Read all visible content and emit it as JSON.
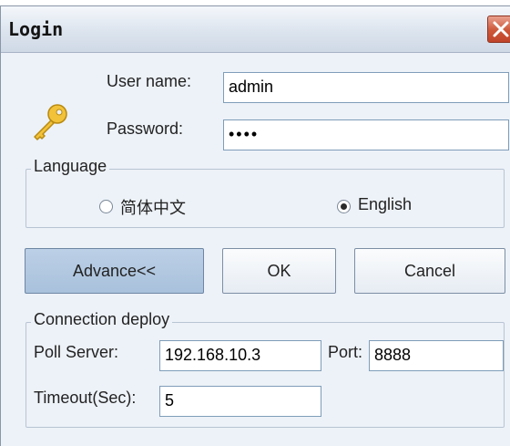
{
  "window": {
    "title": "Login"
  },
  "login": {
    "username_label": "User name:",
    "username_value": "admin",
    "password_label": "Password:",
    "password_mask": "••••"
  },
  "language": {
    "legend": "Language",
    "options": [
      {
        "label": "简体中文",
        "checked": false
      },
      {
        "label": "English",
        "checked": true
      }
    ]
  },
  "buttons": {
    "advance": "Advance<<",
    "ok": "OK",
    "cancel": "Cancel"
  },
  "connection": {
    "legend": "Connection deploy",
    "poll_server_label": "Poll Server:",
    "poll_server_value": "192.168.10.3",
    "port_label": "Port:",
    "port_value": "8888",
    "timeout_label": "Timeout(Sec):",
    "timeout_value": "5"
  },
  "icons": {
    "close": "close-icon",
    "login": "key-icon"
  },
  "colors": {
    "close_button": "#cd5638",
    "active_button": "#b3c8e2",
    "key": "#e8b520"
  }
}
